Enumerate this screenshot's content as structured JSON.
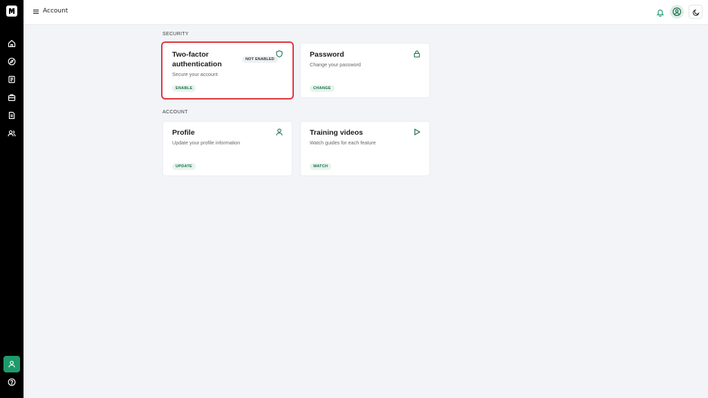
{
  "header": {
    "title": "Account"
  },
  "sections": {
    "security": {
      "label": "SECURITY",
      "cards": [
        {
          "title": "Two-factor authentication",
          "description": "Secure your account",
          "action": "ENABLE",
          "badge": "NOT ENABLED",
          "icon": "shield-icon"
        },
        {
          "title": "Password",
          "description": "Change your password",
          "action": "CHANGE",
          "icon": "lock-icon"
        }
      ]
    },
    "account": {
      "label": "ACCOUNT",
      "cards": [
        {
          "title": "Profile",
          "description": "Update your profile information",
          "action": "UPDATE",
          "icon": "user-icon"
        },
        {
          "title": "Training videos",
          "description": "Watch guides for each feature",
          "action": "WATCH",
          "icon": "play-icon"
        }
      ]
    }
  },
  "colors": {
    "accent": "#1e9a6c",
    "sidebar": "#000000",
    "highlight": "#e0333a"
  }
}
